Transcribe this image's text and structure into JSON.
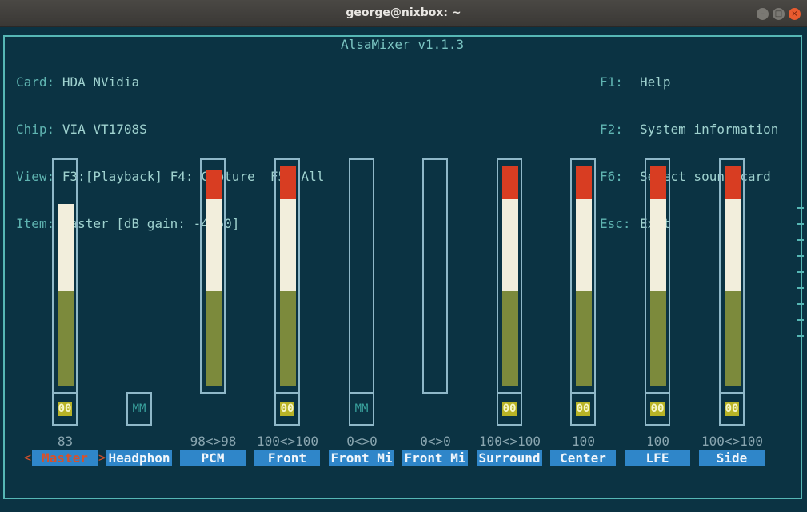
{
  "window": {
    "title": "george@nixbox: ~",
    "buttons": {
      "minimize": "–",
      "maximize": "□",
      "close": "×"
    }
  },
  "app": {
    "title": "AlsaMixer v1.1.3"
  },
  "info": {
    "card_label": "Card:",
    "card": "HDA NVidia",
    "chip_label": "Chip:",
    "chip": "VIA VT1708S",
    "view_label": "View:",
    "view": "F3:[Playback] F4: Capture  F5: All",
    "item_label": "Item:",
    "item": "Master [dB gain: -4.50]"
  },
  "help": [
    {
      "key": "F1:",
      "text": "Help"
    },
    {
      "key": "F2:",
      "text": "System information"
    },
    {
      "key": "F6:",
      "text": "Select sound card"
    },
    {
      "key": "Esc:",
      "text": "Exit"
    }
  ],
  "selection_arrows": {
    "left": "<",
    "right": ">"
  },
  "channels": [
    {
      "name": "Master",
      "value": "83",
      "level": 0.83,
      "mute": "00",
      "muted": false,
      "has_bar": true,
      "selected": true
    },
    {
      "name": "Headphon",
      "value": "",
      "level": 0,
      "mute": "MM",
      "muted": true,
      "has_bar": false,
      "selected": false
    },
    {
      "name": "PCM",
      "value": "98<>98",
      "level": 0.98,
      "mute": "",
      "muted": false,
      "has_bar": true,
      "selected": false
    },
    {
      "name": "Front",
      "value": "100<>100",
      "level": 1.0,
      "mute": "00",
      "muted": false,
      "has_bar": true,
      "selected": false
    },
    {
      "name": "Front Mi",
      "value": "0<>0",
      "level": 0,
      "mute": "MM",
      "muted": true,
      "has_bar": true,
      "selected": false
    },
    {
      "name": "Front Mi",
      "value": "0<>0",
      "level": 0,
      "mute": "",
      "muted": false,
      "has_bar": true,
      "selected": false
    },
    {
      "name": "Surround",
      "value": "100<>100",
      "level": 1.0,
      "mute": "00",
      "muted": false,
      "has_bar": true,
      "selected": false
    },
    {
      "name": "Center",
      "value": "100",
      "level": 1.0,
      "mute": "00",
      "muted": false,
      "has_bar": true,
      "selected": false
    },
    {
      "name": "LFE",
      "value": "100",
      "level": 1.0,
      "mute": "00",
      "muted": false,
      "has_bar": true,
      "selected": false
    },
    {
      "name": "Side",
      "value": "100<>100",
      "level": 1.0,
      "mute": "00",
      "muted": false,
      "has_bar": true,
      "selected": false
    }
  ]
}
